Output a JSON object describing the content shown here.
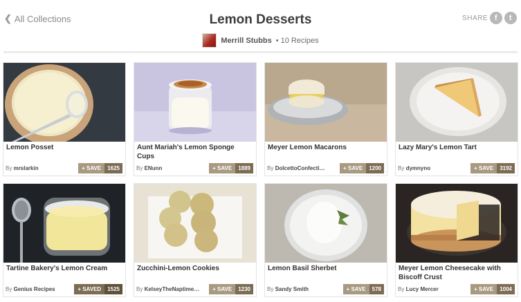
{
  "header": {
    "back_label": "All Collections",
    "title": "Lemon Desserts",
    "author": "Merrill Stubbs",
    "recipe_count": "• 10 Recipes",
    "share_label": "SHARE",
    "icons": [
      "facebook-icon",
      "twitter-icon"
    ]
  },
  "recipes": [
    {
      "title": "Lemon Posset",
      "by_prefix": "By",
      "by": "mrslarkin",
      "save_label": "+ SAVE",
      "count": "1625"
    },
    {
      "title": "Aunt Mariah's Lemon Sponge Cups",
      "by_prefix": "By",
      "by": "ENunn",
      "save_label": "+ SAVE",
      "count": "1889"
    },
    {
      "title": "Meyer Lemon Macarons",
      "by_prefix": "By",
      "by": "DolcettoConfecti…",
      "save_label": "+ SAVE",
      "count": "1200"
    },
    {
      "title": "Lazy Mary's Lemon Tart",
      "by_prefix": "By",
      "by": "dymnyno",
      "save_label": "+ SAVE",
      "count": "3192"
    },
    {
      "title": "Tartine Bakery's Lemon Cream",
      "by_prefix": "By",
      "by": "Genius Recipes",
      "save_label": "+ SAVED",
      "count": "1525"
    },
    {
      "title": "Zucchini-Lemon Cookies",
      "by_prefix": "By",
      "by": "KelseyTheNaptime…",
      "save_label": "+ SAVE",
      "count": "1230"
    },
    {
      "title": "Lemon Basil Sherbet",
      "by_prefix": "By",
      "by": "Sandy Smith",
      "save_label": "+ SAVE",
      "count": "578"
    },
    {
      "title": "Meyer Lemon Cheesecake with Biscoff Crust",
      "by_prefix": "By",
      "by": "Lucy Mercer",
      "save_label": "+ SAVE",
      "count": "1004"
    }
  ]
}
